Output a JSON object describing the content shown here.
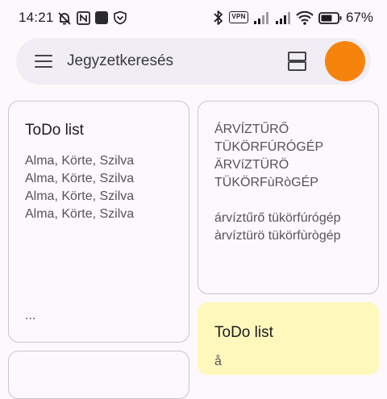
{
  "status_bar": {
    "time": "14:21",
    "vpn_label": "VPN",
    "battery_percent": "67%",
    "icons": [
      "muted-bell-icon",
      "nfc-icon",
      "app-square-icon",
      "shield-icon",
      "bluetooth-icon",
      "vpn-icon",
      "signal-icon",
      "signal-icon",
      "wifi-icon",
      "battery-icon"
    ]
  },
  "search_bar": {
    "placeholder": "Jegyzetkeresés",
    "menu_icon": "hamburger-menu-icon",
    "view_icon": "list-view-icon",
    "avatar_color": "#f6830b"
  },
  "notes": [
    {
      "title": "ToDo list",
      "body": "Alma, Körte, Szilva\nAlma, Körte, Szilva\nAlma, Körte, Szilva\nAlma, Körte, Szilva",
      "ellipsis": "...",
      "color": "#fdf8fc"
    },
    {
      "title": "",
      "body": "ÁRVÍZTŰRŐ\nTÜKÖRFÚRÓGÉP\nÄRVíZTÜRÖ\nTÜKÖRFùRòGÉP\n\nárvíztűrő tükörfúrógép\nàrvíztürö tükörfùrògép",
      "color": "#fdf8fc"
    },
    {
      "title": "ToDo list",
      "body": "å",
      "color": "#fff8bc"
    },
    {
      "title": "",
      "body": "",
      "color": "#fdf8fc"
    }
  ]
}
